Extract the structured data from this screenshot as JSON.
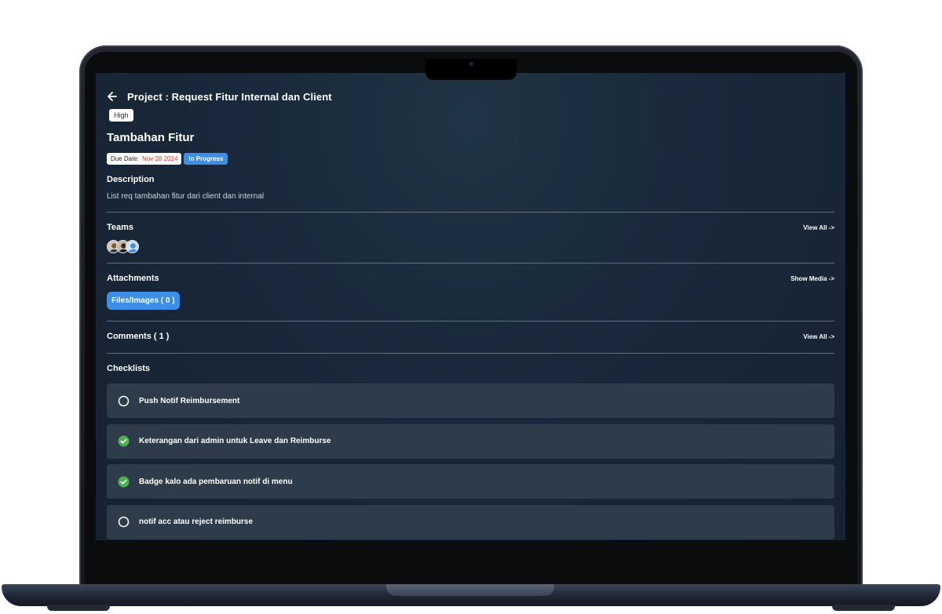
{
  "header": {
    "title": "Project : Request Fitur Internal dan Client"
  },
  "task": {
    "priority": "High",
    "title": "Tambahan Fitur",
    "due_label": "Due Date:",
    "due_value": "Nov 28 2024",
    "status": "In Progress"
  },
  "description": {
    "heading": "Description",
    "text": "List req tambahan fitur dari client dan internal"
  },
  "teams": {
    "heading": "Teams",
    "link": "View All  ->",
    "member_count": 3
  },
  "attachments": {
    "heading": "Attachments",
    "link": "Show Media  ->",
    "files_button": "Files/Images ( 0 )"
  },
  "comments": {
    "heading": "Comments ( 1 )",
    "link": "View All  ->"
  },
  "checklists": {
    "heading": "Checklists",
    "items": [
      {
        "label": "Push Notif Reimbursement",
        "done": false
      },
      {
        "label": "Keterangan dari admin untuk Leave dan Reimburse",
        "done": true
      },
      {
        "label": "Badge kalo ada pembaruan notif di menu",
        "done": true
      },
      {
        "label": "notif acc atau reject reimburse",
        "done": false
      }
    ]
  },
  "colors": {
    "accent_blue": "#3d8ee6",
    "due_red": "#e53935",
    "check_green": "#4caf50",
    "screen_bg": "#19283a"
  }
}
